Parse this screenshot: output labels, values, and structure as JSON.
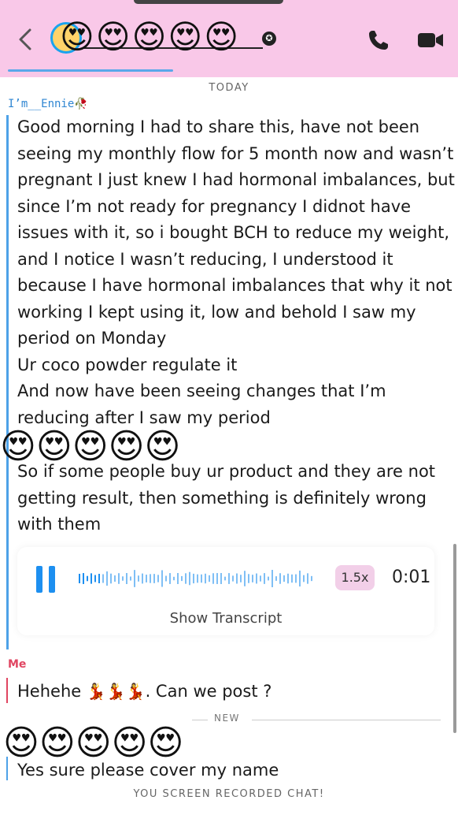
{
  "header": {
    "background": "#f9c8e8",
    "contact_emojis": [
      "😍",
      "😍",
      "😍",
      "😍",
      "😍"
    ],
    "badge": "✪",
    "icons": [
      "back-icon",
      "phone-icon",
      "video-icon"
    ]
  },
  "chat": {
    "day_label": "TODAY",
    "other_sender": "I’m__Ennie🥀",
    "message_1": "Good morning I had to share this, have not been seeing my monthly flow for 5 month now and wasn’t pregnant I just knew I had hormonal imbalances, but since I’m not ready for pregnancy I didnot have issues with it, so i bought BCH to reduce my weight, and I notice I wasn’t reducing, I understood it because I have hormonal imbalances that why it not working I kept using it, low and behold I saw my period on Monday\nUr coco powder regulate it\nAnd now have been seeing changes that I’m reducing after I saw my period",
    "emoji_overlay": [
      "😍",
      "😍",
      "😍",
      "😍",
      "😍"
    ],
    "message_2": "So if some people buy ur product and they are not getting result, then   something is definitely wrong with them",
    "voice_note": {
      "speed": "1.5x",
      "duration": "0:01",
      "transcript_label": "Show Transcript",
      "progress": 0.1
    },
    "me_sender": "Me",
    "me_message_a": "Hehehe ",
    "me_dancers": "💃💃💃",
    "me_message_b": ". Can we post ?",
    "new_label": "NEW",
    "emoji_overlay_2": [
      "😍",
      "😍",
      "😍",
      "😍",
      "😍"
    ],
    "last_message": "Yes sure please cover my name",
    "footer_notice": "YOU SCREEN RECORDED CHAT!"
  },
  "colors": {
    "other_accent": "#4ea2e8",
    "me_accent": "#e04561",
    "play_blue": "#1d8ff0"
  }
}
